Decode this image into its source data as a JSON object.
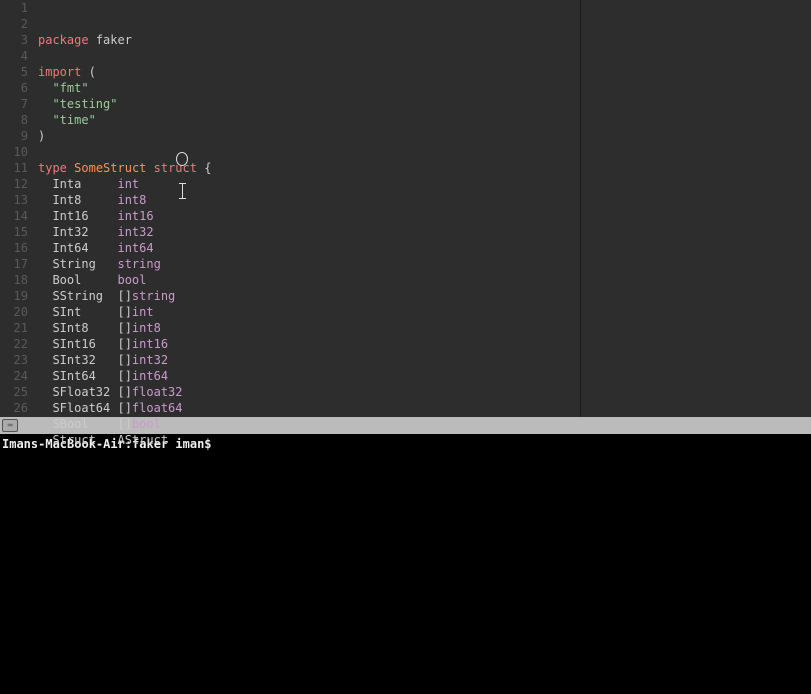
{
  "editor": {
    "lines": [
      {
        "num": 1,
        "tokens": [
          {
            "cls": "kw-red",
            "text": "package"
          },
          {
            "cls": "text-default",
            "text": " "
          },
          {
            "cls": "text-default",
            "text": "faker"
          }
        ]
      },
      {
        "num": 2,
        "tokens": []
      },
      {
        "num": 3,
        "tokens": [
          {
            "cls": "kw-red",
            "text": "import"
          },
          {
            "cls": "text-default",
            "text": " ("
          }
        ]
      },
      {
        "num": 4,
        "tokens": [
          {
            "cls": "text-default",
            "text": "  "
          },
          {
            "cls": "kw-green",
            "text": "\"fmt\""
          }
        ]
      },
      {
        "num": 5,
        "tokens": [
          {
            "cls": "text-default",
            "text": "  "
          },
          {
            "cls": "kw-green",
            "text": "\"testing\""
          }
        ]
      },
      {
        "num": 6,
        "tokens": [
          {
            "cls": "text-default",
            "text": "  "
          },
          {
            "cls": "kw-green",
            "text": "\"time\""
          }
        ]
      },
      {
        "num": 7,
        "tokens": [
          {
            "cls": "text-default",
            "text": ")"
          }
        ]
      },
      {
        "num": 8,
        "tokens": []
      },
      {
        "num": 9,
        "tokens": [
          {
            "cls": "kw-red",
            "text": "type"
          },
          {
            "cls": "text-default",
            "text": " "
          },
          {
            "cls": "kw-orange",
            "text": "SomeStruct"
          },
          {
            "cls": "text-default",
            "text": " "
          },
          {
            "cls": "kw-red",
            "text": "struct"
          },
          {
            "cls": "text-default",
            "text": " {"
          }
        ]
      },
      {
        "num": 10,
        "tokens": [
          {
            "cls": "text-default",
            "text": "  Inta     "
          },
          {
            "cls": "kw-purple",
            "text": "int"
          }
        ]
      },
      {
        "num": 11,
        "tokens": [
          {
            "cls": "text-default",
            "text": "  Int8     "
          },
          {
            "cls": "kw-purple",
            "text": "int8"
          }
        ]
      },
      {
        "num": 12,
        "tokens": [
          {
            "cls": "text-default",
            "text": "  Int16    "
          },
          {
            "cls": "kw-purple",
            "text": "int16"
          }
        ]
      },
      {
        "num": 13,
        "tokens": [
          {
            "cls": "text-default",
            "text": "  Int32    "
          },
          {
            "cls": "kw-purple",
            "text": "int32"
          }
        ]
      },
      {
        "num": 14,
        "tokens": [
          {
            "cls": "text-default",
            "text": "  Int64    "
          },
          {
            "cls": "kw-purple",
            "text": "int64"
          }
        ]
      },
      {
        "num": 15,
        "tokens": [
          {
            "cls": "text-default",
            "text": "  String   "
          },
          {
            "cls": "kw-purple",
            "text": "string"
          }
        ]
      },
      {
        "num": 16,
        "tokens": [
          {
            "cls": "text-default",
            "text": "  Bool     "
          },
          {
            "cls": "kw-purple",
            "text": "bool"
          }
        ]
      },
      {
        "num": 17,
        "tokens": [
          {
            "cls": "text-default",
            "text": "  SString  []"
          },
          {
            "cls": "kw-purple",
            "text": "string"
          }
        ]
      },
      {
        "num": 18,
        "tokens": [
          {
            "cls": "text-default",
            "text": "  SInt     []"
          },
          {
            "cls": "kw-purple",
            "text": "int"
          }
        ]
      },
      {
        "num": 19,
        "tokens": [
          {
            "cls": "text-default",
            "text": "  SInt8    []"
          },
          {
            "cls": "kw-purple",
            "text": "int8"
          }
        ]
      },
      {
        "num": 20,
        "tokens": [
          {
            "cls": "text-default",
            "text": "  SInt16   []"
          },
          {
            "cls": "kw-purple",
            "text": "int16"
          }
        ]
      },
      {
        "num": 21,
        "tokens": [
          {
            "cls": "text-default",
            "text": "  SInt32   []"
          },
          {
            "cls": "kw-purple",
            "text": "int32"
          }
        ]
      },
      {
        "num": 22,
        "tokens": [
          {
            "cls": "text-default",
            "text": "  SInt64   []"
          },
          {
            "cls": "kw-purple",
            "text": "int64"
          }
        ]
      },
      {
        "num": 23,
        "tokens": [
          {
            "cls": "text-default",
            "text": "  SFloat32 []"
          },
          {
            "cls": "kw-purple",
            "text": "float32"
          }
        ]
      },
      {
        "num": 24,
        "tokens": [
          {
            "cls": "text-default",
            "text": "  SFloat64 []"
          },
          {
            "cls": "kw-purple",
            "text": "float64"
          }
        ]
      },
      {
        "num": 25,
        "tokens": [
          {
            "cls": "text-default",
            "text": "  SBool    []"
          },
          {
            "cls": "kw-purple",
            "text": "bool"
          }
        ]
      },
      {
        "num": 26,
        "tokens": [
          {
            "cls": "text-default",
            "text": "  Struct   AStruct"
          }
        ]
      }
    ]
  },
  "statusbar": {
    "icon_glyph": "⌨"
  },
  "terminal": {
    "prompt": "Imans-MacBook-Air:faker iman$ "
  }
}
